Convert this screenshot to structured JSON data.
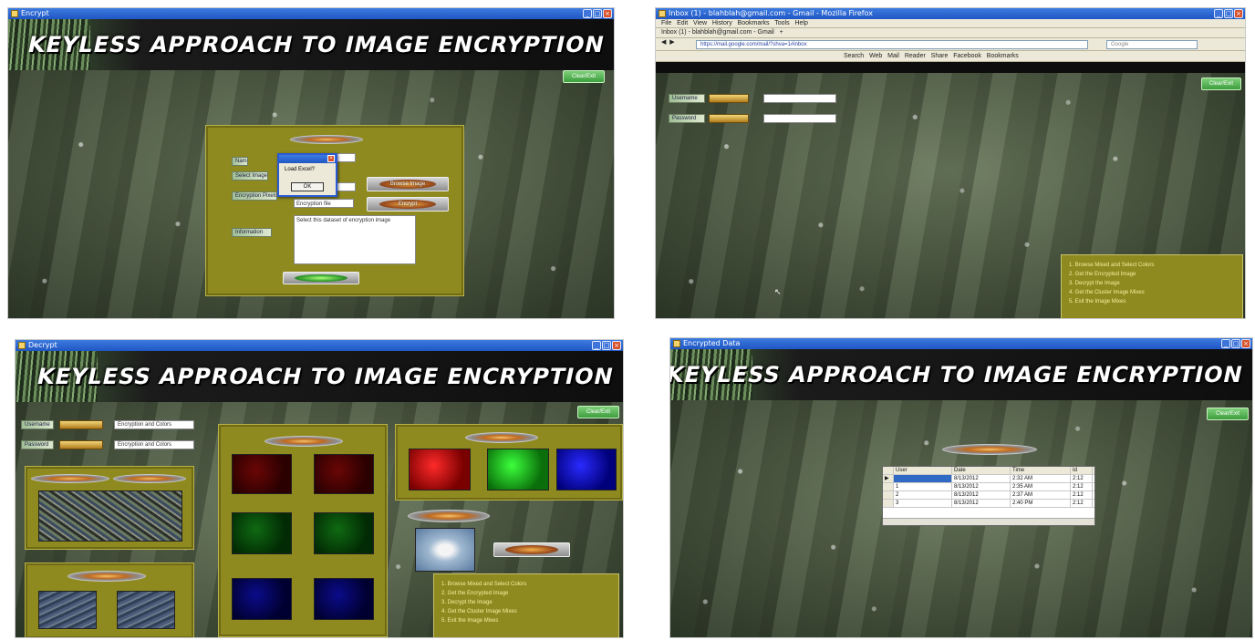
{
  "screens": {
    "top_left": {
      "window_title": "Encrypt",
      "banner_title": "KEYLESS APPROACH TO IMAGE ENCRYPTION",
      "corner_button": "Clear/Exit",
      "dialog_message": "Load Excel?",
      "dialog_ok": "OK",
      "info_text": "Select this dataset of encryption image",
      "field_labels": [
        "Name",
        "Select Image",
        "Encryption Pixels",
        "Information"
      ],
      "field_value": "Encryption file",
      "button_labels": [
        "Browse Image",
        "Encrypt"
      ]
    },
    "top_right": {
      "browser_title": "Inbox (1) - blahblah@gmail.com - Gmail - Mozilla Firefox",
      "menu_items": [
        "File",
        "Edit",
        "View",
        "History",
        "Bookmarks",
        "Tools",
        "Help"
      ],
      "tab_label": "Inbox (1) - blahblah@gmail.com - Gmail",
      "url": "https://mail.google.com/mail/?shva=1#inbox",
      "search_placeholder": "Google",
      "toolbar_items": [
        "Search",
        "Web",
        "Mail",
        "Reader",
        "Share",
        "Facebook",
        "Bookmarks"
      ],
      "corner_button": "Clear/Exit",
      "field_labels": [
        "Username",
        "Password"
      ],
      "steps": [
        "1. Browse Mixed and Select Colors",
        "2. Get the Encrypted Image",
        "3. Decrypt the Image",
        "4. Get the Cluster Image Mixes",
        "5. Exit the Image Mixes"
      ]
    },
    "bottom_left": {
      "window_title": "Decrypt",
      "banner_title": "KEYLESS APPROACH TO IMAGE ENCRYPTION",
      "corner_button": "Clear/Exit",
      "field_labels": [
        "Username",
        "Password"
      ],
      "field_values": [
        "Encryption and Colors",
        "Encryption and Colors"
      ],
      "steps": [
        "1. Browse Mixed and Select Colors",
        "2. Get the Encrypted Image",
        "3. Decrypt the Image",
        "4. Get the Cluster Image Mixes",
        "5. Exit the Image Mixes"
      ]
    },
    "bottom_right": {
      "window_title": "Encrypted Data",
      "banner_title": "KEYLESS APPROACH TO IMAGE ENCRYPTION",
      "corner_button": "Clear/Exit",
      "table": {
        "columns": [
          "User",
          "Date",
          "Time",
          "Id"
        ],
        "rows": [
          [
            "",
            "8/13/2012",
            "2:32 AM",
            "2:12"
          ],
          [
            "1",
            "8/13/2012",
            "2:35 AM",
            "2:12"
          ],
          [
            "2",
            "8/13/2012",
            "2:37 AM",
            "2:12"
          ],
          [
            "3",
            "8/13/2012",
            "2:40 PM",
            "2:12"
          ]
        ]
      }
    }
  }
}
